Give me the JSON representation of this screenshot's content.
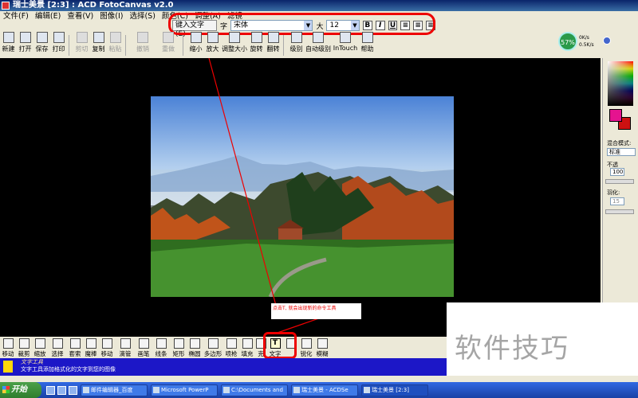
{
  "window": {
    "title": "瑞士美景 [2:3] : ACD FotoCanvas v2.0"
  },
  "menu": [
    "文件(F)",
    "编辑(E)",
    "查看(V)",
    "图像(I)",
    "选择(S)",
    "颜色(C)",
    "调整(A)",
    "滤镜"
  ],
  "text_toolbar": {
    "enter_text_label": "键入文字(E)",
    "font_label": "字",
    "font_value": "宋体",
    "size_label": "大",
    "size_value": "12",
    "bold": "B",
    "italic": "I",
    "underline": "U",
    "align_left": "≡",
    "align_center": "≡",
    "align_right": "≡"
  },
  "toolbar": [
    {
      "label": "新建",
      "icon": "new-icon",
      "enabled": true
    },
    {
      "label": "打开",
      "icon": "open-folder-icon",
      "enabled": true
    },
    {
      "label": "保存",
      "icon": "save-icon",
      "enabled": true
    },
    {
      "label": "打印",
      "icon": "print-icon",
      "enabled": true
    },
    {
      "label": "剪切",
      "icon": "cut-icon",
      "enabled": false
    },
    {
      "label": "复制",
      "icon": "copy-icon",
      "enabled": true
    },
    {
      "label": "粘贴",
      "icon": "paste-icon",
      "enabled": false
    },
    {
      "label": "撤销",
      "icon": "undo-icon",
      "enabled": false
    },
    {
      "label": "重做",
      "icon": "redo-icon",
      "enabled": false
    },
    {
      "label": "缩小",
      "icon": "zoom-out-icon",
      "enabled": true
    },
    {
      "label": "放大",
      "icon": "zoom-in-icon",
      "enabled": true
    },
    {
      "label": "调整大小",
      "icon": "resize-icon",
      "enabled": true
    },
    {
      "label": "旋转",
      "icon": "rotate-icon",
      "enabled": true
    },
    {
      "label": "翻转",
      "icon": "flip-icon",
      "enabled": true
    },
    {
      "label": "级别",
      "icon": "levels-icon",
      "enabled": true
    },
    {
      "label": "自动级别",
      "icon": "auto-levels-icon",
      "enabled": true
    },
    {
      "label": "InTouch",
      "icon": "intouch-icon",
      "enabled": true
    },
    {
      "label": "帮助",
      "icon": "help-icon",
      "enabled": true
    }
  ],
  "network": {
    "percent": "57%",
    "upload": "0K/s",
    "download": "0.5K/s"
  },
  "right_panel": {
    "fg_color": "#e5138f",
    "bg_color": "#cc1111",
    "blend_label": "混合模式:",
    "blend_value": "标准",
    "opacity_label": "不透",
    "opacity_value": "100",
    "feather_label": "羽化:",
    "feather_value": "15"
  },
  "callout": {
    "text": "点击T, 就会出现新的命令工具"
  },
  "bottom_tools": [
    {
      "label": "移动",
      "icon": "hand-icon",
      "active": false
    },
    {
      "label": "裁剪",
      "icon": "crop-icon",
      "active": false
    },
    {
      "label": "缩放",
      "icon": "magnify-icon",
      "active": false
    },
    {
      "label": "选择",
      "icon": "rect-select-icon",
      "active": false
    },
    {
      "label": "套索",
      "icon": "lasso-icon",
      "active": false
    },
    {
      "label": "魔棒",
      "icon": "magic-wand-icon",
      "active": false
    },
    {
      "label": "移动",
      "icon": "move-cross-icon",
      "active": false
    },
    {
      "label": "滴管",
      "icon": "eyedropper-icon",
      "active": false
    },
    {
      "label": "画笔",
      "icon": "brush-icon",
      "active": false
    },
    {
      "label": "线条",
      "icon": "line-icon",
      "active": false
    },
    {
      "label": "矩形",
      "icon": "rectangle-icon",
      "active": false
    },
    {
      "label": "椭圆",
      "icon": "ellipse-icon",
      "active": false
    },
    {
      "label": "多边形",
      "icon": "polygon-icon",
      "active": false
    },
    {
      "label": "喷枪",
      "icon": "airbrush-icon",
      "active": false
    },
    {
      "label": "填充",
      "icon": "fill-bucket-icon",
      "active": false
    },
    {
      "label": "克",
      "icon": "clone-icon",
      "active": false
    },
    {
      "label": "文字",
      "icon": "text-icon",
      "active": true
    },
    {
      "label": "",
      "icon": "drop-icon",
      "active": false
    },
    {
      "label": "锐化",
      "icon": "sharpen-icon",
      "active": false
    },
    {
      "label": "模糊",
      "icon": "blur-icon",
      "active": false
    }
  ],
  "status": {
    "title": "文字工具",
    "desc": "文字工具添加格式化的文字到您的图像"
  },
  "watermark": "软件技巧",
  "taskbar": {
    "start": "开始",
    "tasks": [
      "邮件编辑器_百度",
      "Microsoft PowerP",
      "C:\\Documents and",
      "瑞士美景 - ACDSe",
      "瑞士美景 [2:3]"
    ]
  }
}
